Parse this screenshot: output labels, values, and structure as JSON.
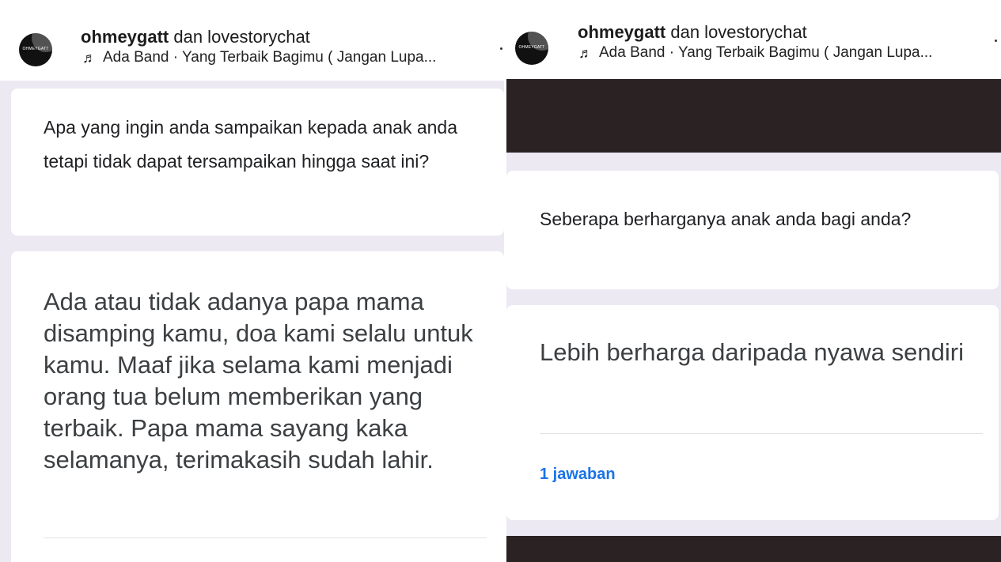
{
  "left": {
    "header": {
      "avatar_text": "OHMEYGATT",
      "author_primary": "ohmeygatt",
      "author_rest": " dan lovestorychat",
      "music_icon": "music-note-icon",
      "music_text": "Ada Band · Yang Terbaik Bagimu ( Jangan Lupa..."
    },
    "question": "Apa yang ingin anda sampaikan kepada anak anda tetapi tidak dapat tersampaikan hingga saat ini?",
    "answer": "Ada atau tidak adanya papa mama disamping kamu, doa kami selalu untuk kamu. Maaf jika selama kami menjadi orang tua belum memberikan yang terbaik. Papa mama sayang kaka selamanya, terimakasih sudah lahir."
  },
  "right": {
    "header": {
      "avatar_text": "OHMEYGATT",
      "author_primary": "ohmeygatt",
      "author_rest": " dan lovestorychat",
      "music_icon": "music-note-icon",
      "music_text": "Ada Band · Yang Terbaik Bagimu ( Jangan Lupa..."
    },
    "question": "Seberapa berharganya anak anda bagi anda?",
    "answer": "Lebih berharga daripada nyawa sendiri",
    "response_count": "1 jawaban"
  },
  "colors": {
    "background": "#ede9f3",
    "card": "#ffffff",
    "dark_band": "#2b2323",
    "link_blue": "#1a73e8"
  }
}
